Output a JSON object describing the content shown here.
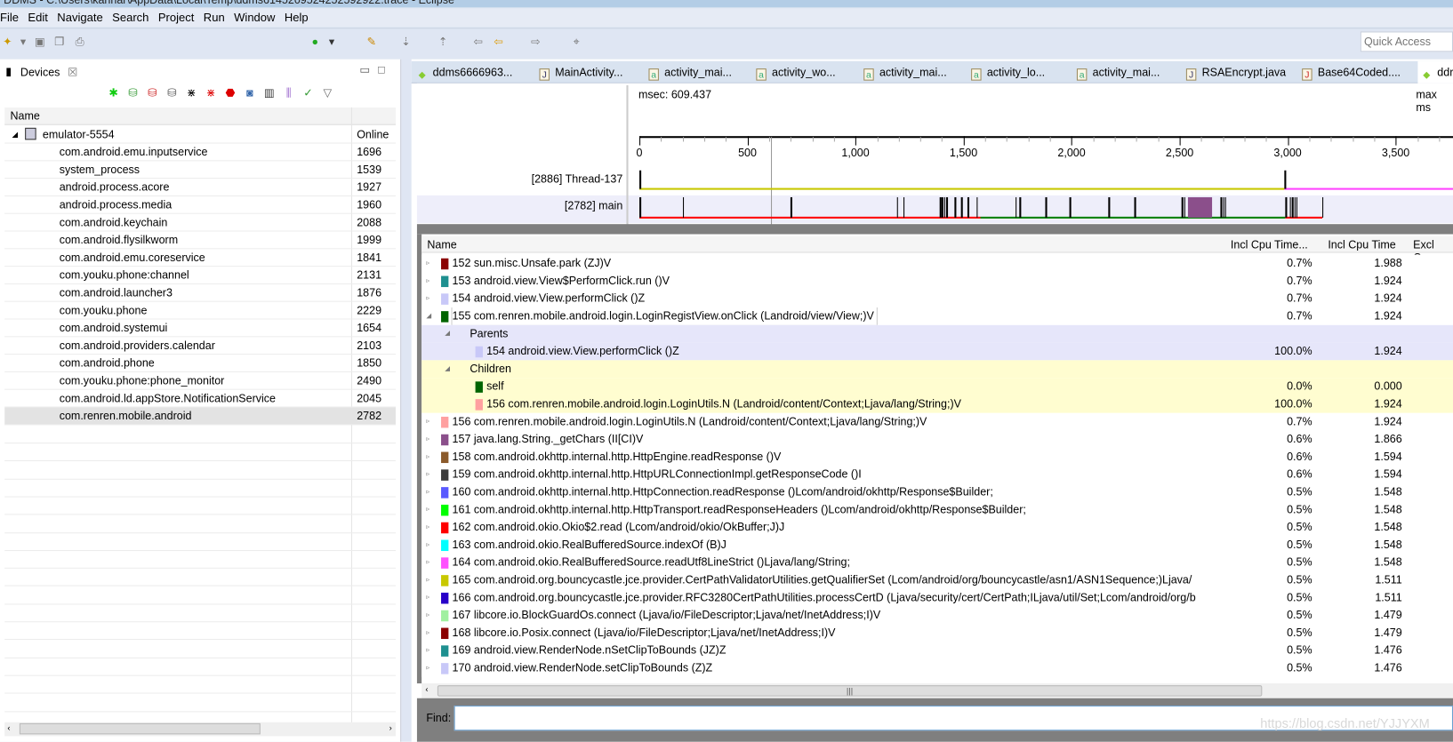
{
  "window": {
    "title": "DDMS - C:\\Users\\kannar\\AppData\\Local\\Temp\\ddms6145209524252592922.trace - Eclipse"
  },
  "menu": [
    "File",
    "Edit",
    "Navigate",
    "Search",
    "Project",
    "Run",
    "Window",
    "Help"
  ],
  "quick_access": {
    "placeholder": "Quick Access"
  },
  "devices": {
    "tab": "Devices",
    "column_name": "Name",
    "device": {
      "name": "emulator-5554",
      "status": "Online"
    },
    "processes": [
      {
        "name": "com.android.emu.inputservice",
        "pid": "1696"
      },
      {
        "name": "system_process",
        "pid": "1539"
      },
      {
        "name": "android.process.acore",
        "pid": "1927"
      },
      {
        "name": "android.process.media",
        "pid": "1960"
      },
      {
        "name": "com.android.keychain",
        "pid": "2088"
      },
      {
        "name": "com.android.flysilkworm",
        "pid": "1999"
      },
      {
        "name": "com.android.emu.coreservice",
        "pid": "1841"
      },
      {
        "name": "com.youku.phone:channel",
        "pid": "2131"
      },
      {
        "name": "com.android.launcher3",
        "pid": "1876"
      },
      {
        "name": "com.youku.phone",
        "pid": "2229"
      },
      {
        "name": "com.android.systemui",
        "pid": "1654"
      },
      {
        "name": "com.android.providers.calendar",
        "pid": "2103"
      },
      {
        "name": "com.android.phone",
        "pid": "1850"
      },
      {
        "name": "com.youku.phone:phone_monitor",
        "pid": "2490"
      },
      {
        "name": "com.android.ld.appStore.NotificationService",
        "pid": "2045"
      },
      {
        "name": "com.renren.mobile.android",
        "pid": "2782",
        "selected": true
      }
    ]
  },
  "editor_tabs": [
    {
      "label": "ddms6666963...",
      "icon": "android-icon"
    },
    {
      "label": "MainActivity...",
      "icon": "java-file-icon"
    },
    {
      "label": "activity_mai...",
      "icon": "xml-file-icon"
    },
    {
      "label": "activity_wo...",
      "icon": "xml-file-icon"
    },
    {
      "label": "activity_mai...",
      "icon": "xml-file-icon"
    },
    {
      "label": "activity_lo...",
      "icon": "xml-file-icon"
    },
    {
      "label": "activity_mai...",
      "icon": "xml-file-icon"
    },
    {
      "label": "RSAEncrypt.java",
      "icon": "java-file-icon"
    },
    {
      "label": "Base64Coded....",
      "icon": "java-error-file-icon"
    },
    {
      "label": "ddr",
      "icon": "android-icon",
      "active": true
    }
  ],
  "timeline": {
    "msec_label": "msec: 609.437",
    "max_label": "max ms",
    "ticks": [
      "0",
      "500",
      "1,000",
      "1,500",
      "2,000",
      "2,500",
      "3,000",
      "3,500"
    ],
    "cursor_ms": 609.437,
    "threads": [
      {
        "label": "[2886] Thread-137",
        "events_ms": [
          0,
          2985
        ],
        "segments": [
          {
            "from": 0,
            "to": 2985,
            "color": "#c8c800"
          },
          {
            "from": 2985,
            "to": 4000,
            "color": "#ff44ff"
          }
        ]
      },
      {
        "label": "[2782] main",
        "events_ms": [
          0,
          200,
          700,
          1190,
          1220,
          1390,
          1400,
          1410,
          1420,
          1460,
          1490,
          1520,
          1560,
          1740,
          1760,
          1880,
          1990,
          2170,
          2290,
          2510,
          2520,
          2690,
          2700,
          2710,
          2990,
          3010,
          3020,
          3030,
          3040,
          3160
        ],
        "segments": [
          {
            "from": 0,
            "to": 1580,
            "color": "#ff0000"
          },
          {
            "from": 1580,
            "to": 2990,
            "color": "#008000"
          },
          {
            "from": 2990,
            "to": 3160,
            "color": "#ff0000"
          }
        ],
        "block": {
          "from": 2540,
          "to": 2650,
          "color": "#8b4f8b"
        }
      }
    ]
  },
  "profile": {
    "columns": [
      "Name",
      "Incl Cpu Time...",
      "Incl Cpu Time",
      "Excl Cpu"
    ],
    "rows": [
      {
        "name": "152 sun.misc.Unsafe.park (ZJ)V",
        "color": "#8b0000",
        "pct": "0.7%",
        "time": "1.988",
        "level": 0,
        "twisty": "▹"
      },
      {
        "name": "153 android.view.View$PerformClick.run ()V",
        "color": "#1e9090",
        "pct": "0.7%",
        "time": "1.924",
        "level": 0,
        "twisty": "▹"
      },
      {
        "name": "154 android.view.View.performClick ()Z",
        "color": "#c8c8f8",
        "pct": "0.7%",
        "time": "1.924",
        "level": 0,
        "twisty": "▹"
      },
      {
        "name": "155 com.renren.mobile.android.login.LoginRegistView.onClick (Landroid/view/View;)V",
        "color": "#006400",
        "pct": "0.7%",
        "time": "1.924",
        "level": 0,
        "twisty": "◢",
        "focused": true
      },
      {
        "name": "Parents",
        "level": 1,
        "twisty": "◢",
        "bg": "parents"
      },
      {
        "name": "154 android.view.View.performClick ()Z",
        "color": "#c8c8f8",
        "pct": "100.0%",
        "time": "1.924",
        "level": 2,
        "bg": "parents"
      },
      {
        "name": "Children",
        "level": 1,
        "twisty": "◢",
        "bg": "children"
      },
      {
        "name": "self",
        "color": "#006400",
        "pct": "0.0%",
        "time": "0.000",
        "level": 2,
        "bg": "children"
      },
      {
        "name": "156 com.renren.mobile.android.login.LoginUtils.N (Landroid/content/Context;Ljava/lang/String;)V",
        "color": "#ffa0a0",
        "pct": "100.0%",
        "time": "1.924",
        "level": 2,
        "bg": "children"
      },
      {
        "name": "156 com.renren.mobile.android.login.LoginUtils.N (Landroid/content/Context;Ljava/lang/String;)V",
        "color": "#ffa0a0",
        "pct": "0.7%",
        "time": "1.924",
        "level": 0,
        "twisty": "▹"
      },
      {
        "name": "157 java.lang.String._getChars (II[CI)V",
        "color": "#8b4f8b",
        "pct": "0.6%",
        "time": "1.866",
        "level": 0,
        "twisty": "▹"
      },
      {
        "name": "158 com.android.okhttp.internal.http.HttpEngine.readResponse ()V",
        "color": "#8b5a2b",
        "pct": "0.6%",
        "time": "1.594",
        "level": 0,
        "twisty": "▹"
      },
      {
        "name": "159 com.android.okhttp.internal.http.HttpURLConnectionImpl.getResponseCode ()I",
        "color": "#3c3c3c",
        "pct": "0.6%",
        "time": "1.594",
        "level": 0,
        "twisty": "▹"
      },
      {
        "name": "160 com.android.okhttp.internal.http.HttpConnection.readResponse ()Lcom/android/okhttp/Response$Builder;",
        "color": "#5a5aff",
        "pct": "0.5%",
        "time": "1.548",
        "level": 0,
        "twisty": "▹"
      },
      {
        "name": "161 com.android.okhttp.internal.http.HttpTransport.readResponseHeaders ()Lcom/android/okhttp/Response$Builder;",
        "color": "#00ff00",
        "pct": "0.5%",
        "time": "1.548",
        "level": 0,
        "twisty": "▹"
      },
      {
        "name": "162 com.android.okio.Okio$2.read (Lcom/android/okio/OkBuffer;J)J",
        "color": "#ff0000",
        "pct": "0.5%",
        "time": "1.548",
        "level": 0,
        "twisty": "▹"
      },
      {
        "name": "163 com.android.okio.RealBufferedSource.indexOf (B)J",
        "color": "#00ffff",
        "pct": "0.5%",
        "time": "1.548",
        "level": 0,
        "twisty": "▹"
      },
      {
        "name": "164 com.android.okio.RealBufferedSource.readUtf8LineStrict ()Ljava/lang/String;",
        "color": "#ff50ff",
        "pct": "0.5%",
        "time": "1.548",
        "level": 0,
        "twisty": "▹"
      },
      {
        "name": "165 com.android.org.bouncycastle.jce.provider.CertPathValidatorUtilities.getQualifierSet (Lcom/android/org/bouncycastle/asn1/ASN1Sequence;)Ljava/",
        "color": "#c8c800",
        "pct": "0.5%",
        "time": "1.511",
        "level": 0,
        "twisty": "▹"
      },
      {
        "name": "166 com.android.org.bouncycastle.jce.provider.RFC3280CertPathUtilities.processCertD (Ljava/security/cert/CertPath;ILjava/util/Set;Lcom/android/org/b",
        "color": "#2800c8",
        "pct": "0.5%",
        "time": "1.511",
        "level": 0,
        "twisty": "▹"
      },
      {
        "name": "167 libcore.io.BlockGuardOs.connect (Ljava/io/FileDescriptor;Ljava/net/InetAddress;I)V",
        "color": "#a0f0a0",
        "pct": "0.5%",
        "time": "1.479",
        "level": 0,
        "twisty": "▹"
      },
      {
        "name": "168 libcore.io.Posix.connect (Ljava/io/FileDescriptor;Ljava/net/InetAddress;I)V",
        "color": "#8b0000",
        "pct": "0.5%",
        "time": "1.479",
        "level": 0,
        "twisty": "▹"
      },
      {
        "name": "169 android.view.RenderNode.nSetClipToBounds (JZ)Z",
        "color": "#1e9090",
        "pct": "0.5%",
        "time": "1.476",
        "level": 0,
        "twisty": "▹"
      },
      {
        "name": "170 android.view.RenderNode.setClipToBounds (Z)Z",
        "color": "#c8c8f8",
        "pct": "0.5%",
        "time": "1.476",
        "level": 0,
        "twisty": "▹"
      }
    ],
    "parents_bg": "#e6e6fa",
    "children_bg": "#fffdd0"
  },
  "find": {
    "label": "Find:",
    "value": ""
  },
  "watermark": "https://blog.csdn.net/YJJYXM"
}
